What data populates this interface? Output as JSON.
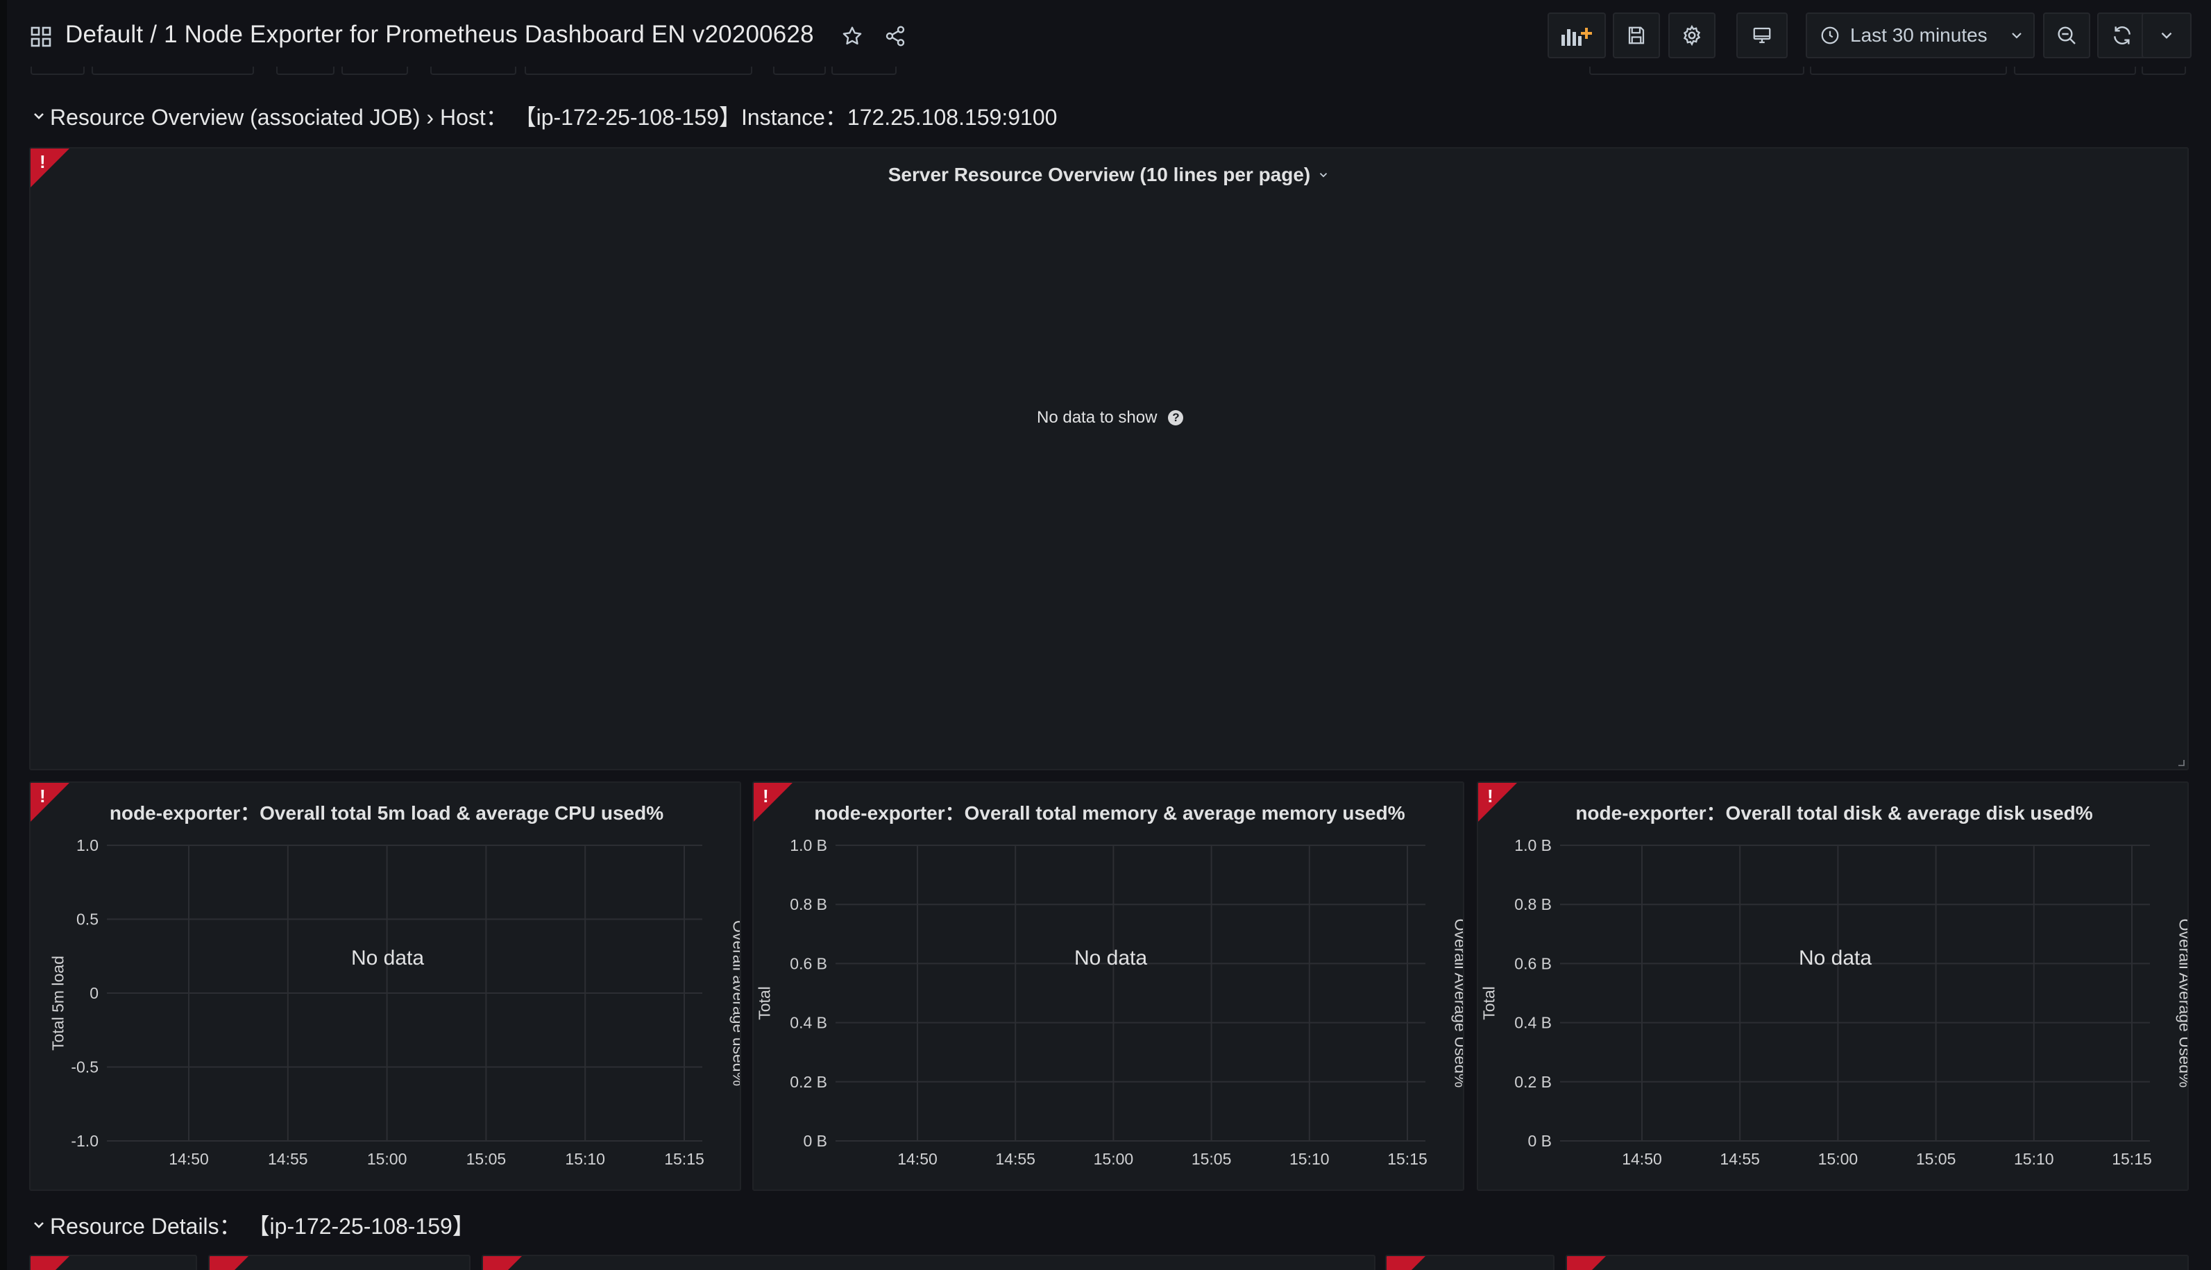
{
  "header": {
    "title": "Default / 1 Node Exporter for Prometheus Dashboard EN v20200628",
    "time_range": "Last 30 minutes"
  },
  "icons": {
    "apps": "apps-grid-icon",
    "star": "star-icon",
    "share": "share-icon",
    "add_panel": "add-panel-icon",
    "save": "save-icon",
    "settings": "gear-icon",
    "tv": "tv-mode-icon",
    "clock": "clock-icon",
    "zoom_out": "zoom-out-icon",
    "refresh": "refresh-icon",
    "dropdown": "chevron-down-icon"
  },
  "rows": {
    "overview": {
      "title": "Resource Overview (associated JOB) › Host： 【ip-172-25-108-159】Instance：172.25.108.159:9100"
    },
    "details": {
      "title": "Resource Details： 【ip-172-25-108-159】"
    }
  },
  "panels": {
    "server_overview": {
      "title": "Server Resource Overview (10 lines per page)",
      "message": "No data to show"
    },
    "cpu": {
      "title": "node-exporter：Overall total 5m load & average CPU used%",
      "no_data": "No data",
      "left_axis_label": "Total 5m load",
      "right_axis_label": "Overall average used%"
    },
    "memory": {
      "title": "node-exporter：Overall total memory & average memory used%",
      "no_data": "No data",
      "left_axis_label": "Total",
      "right_axis_label": "Overall Average Used%"
    },
    "disk": {
      "title": "node-exporter：Overall total disk & average disk used%",
      "no_data": "No data",
      "left_axis_label": "Total",
      "right_axis_label": "Overall Average Used%"
    }
  },
  "colors": {
    "background": "#111217",
    "panel": "#181b1f",
    "error_corner": "#c4162a",
    "grid": "#2c2e33"
  },
  "chart_data": [
    {
      "type": "line",
      "title": "node-exporter：Overall total 5m load & average CPU used%",
      "ylabel": "Total 5m load",
      "y2label": "Overall average used%",
      "x_ticks": [
        "14:50",
        "14:55",
        "15:00",
        "15:05",
        "15:10",
        "15:15"
      ],
      "y_ticks": [
        "1.0",
        "0.5",
        "0",
        "-0.5",
        "-1.0"
      ],
      "ylim": [
        -1.0,
        1.0
      ],
      "series": [],
      "grid": true
    },
    {
      "type": "line",
      "title": "node-exporter：Overall total memory & average memory used%",
      "ylabel": "Total",
      "y2label": "Overall Average Used%",
      "x_ticks": [
        "14:50",
        "14:55",
        "15:00",
        "15:05",
        "15:10",
        "15:15"
      ],
      "y_ticks": [
        "1.0 B",
        "0.8 B",
        "0.6 B",
        "0.4 B",
        "0.2 B",
        "0 B"
      ],
      "ylim": [
        0,
        1.0
      ],
      "series": [],
      "grid": true
    },
    {
      "type": "line",
      "title": "node-exporter：Overall total disk & average disk used%",
      "ylabel": "Total",
      "y2label": "Overall Average Used%",
      "x_ticks": [
        "14:50",
        "14:55",
        "15:00",
        "15:05",
        "15:10",
        "15:15"
      ],
      "y_ticks": [
        "1.0 B",
        "0.8 B",
        "0.6 B",
        "0.4 B",
        "0.2 B",
        "0 B"
      ],
      "ylim": [
        0,
        1.0
      ],
      "series": [],
      "grid": true
    }
  ]
}
